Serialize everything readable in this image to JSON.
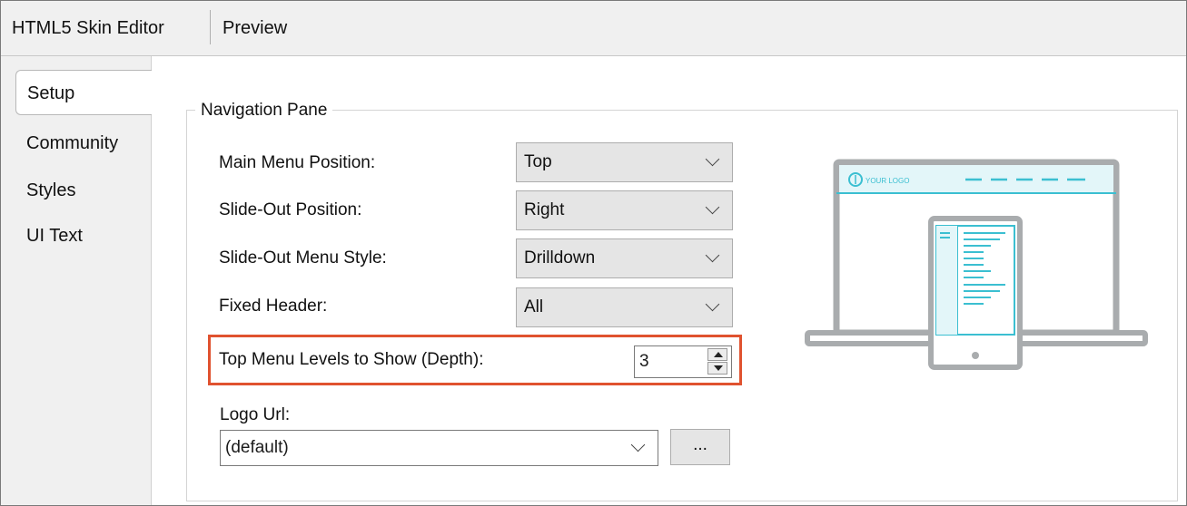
{
  "top_tabs": [
    "HTML5 Skin Editor",
    "Preview"
  ],
  "side_tabs": [
    "Setup",
    "Community",
    "Styles",
    "UI Text"
  ],
  "active_side_tab": "Setup",
  "navigation_pane": {
    "title": "Navigation Pane",
    "main_menu_position": {
      "label": "Main Menu Position:",
      "value": "Top"
    },
    "slide_out_position": {
      "label": "Slide-Out Position:",
      "value": "Right"
    },
    "slide_out_menu_style": {
      "label": "Slide-Out Menu Style:",
      "value": "Drilldown"
    },
    "fixed_header": {
      "label": "Fixed Header:",
      "value": "All"
    },
    "top_menu_levels": {
      "label": "Top Menu Levels to Show (Depth):",
      "value": "3"
    },
    "logo_url": {
      "label": "Logo Url:",
      "value": "(default)",
      "browse_label": "..."
    }
  },
  "preview_image": {
    "logo_text": "YOUR LOGO"
  },
  "colors": {
    "highlight": "#e0522f",
    "accent": "#3bbfd1"
  }
}
